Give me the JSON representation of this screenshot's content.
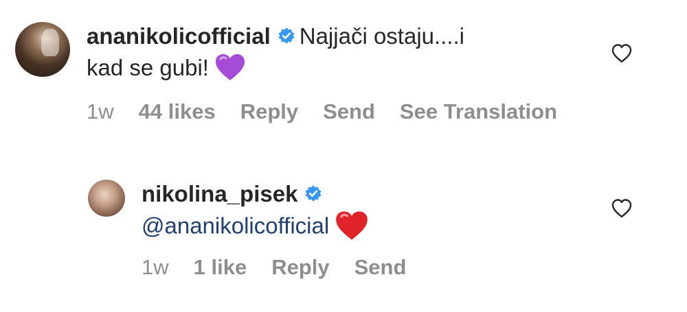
{
  "comments": [
    {
      "username": "ananikolicofficial",
      "text_line1": "Najjači ostaju....i",
      "text_line2": "kad se gubi!",
      "emoji": "purple-heart",
      "time": "1w",
      "likes": "44 likes",
      "reply": "Reply",
      "send": "Send",
      "translation": "See Translation"
    },
    {
      "username": "nikolina_pisek",
      "mention": "@ananikolicofficial",
      "emoji": "red-heart",
      "time": "1w",
      "likes": "1 like",
      "reply": "Reply",
      "send": "Send"
    }
  ],
  "colors": {
    "text": "#262626",
    "meta": "#8e8e8e",
    "verified": "#3897f0",
    "mention": "#1f3f6e",
    "purple_heart": "#a64bd8",
    "red_heart": "#e0242a"
  }
}
